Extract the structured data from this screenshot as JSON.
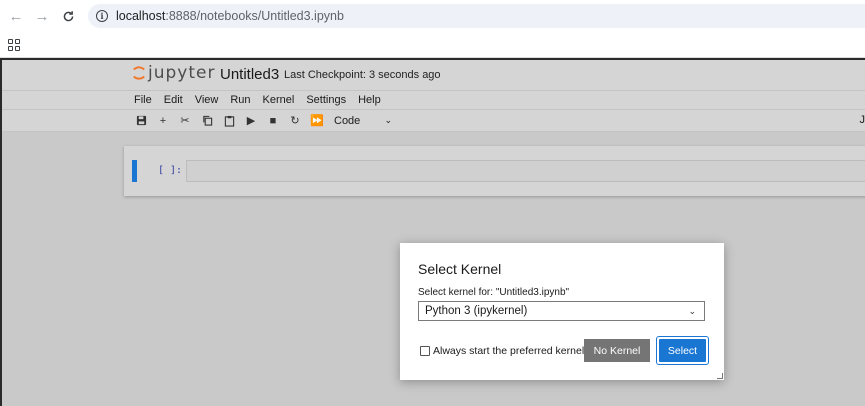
{
  "browser": {
    "url_host": "localhost",
    "url_path": ":8888/notebooks/Untitled3.ipynb"
  },
  "jupyter": {
    "logo_text": "jupyter",
    "notebook_title": "Untitled3",
    "checkpoint": "Last Checkpoint: 3 seconds ago",
    "menu": [
      "File",
      "Edit",
      "View",
      "Run",
      "Kernel",
      "Settings",
      "Help"
    ],
    "cell_type": "Code",
    "toolbar_right": "J",
    "cell_prompt": "[ ]:"
  },
  "dialog": {
    "title": "Select Kernel",
    "kernel_for": "Select kernel for: \"Untitled3.ipynb\"",
    "selected_kernel": "Python 3 (ipykernel)",
    "preferred_label": "Always start the preferred kernel",
    "no_kernel_label": "No Kernel",
    "select_label": "Select"
  },
  "colors": {
    "accent": "#1976d2",
    "secondary_button": "#757575",
    "logo_orange": "#f37626"
  }
}
